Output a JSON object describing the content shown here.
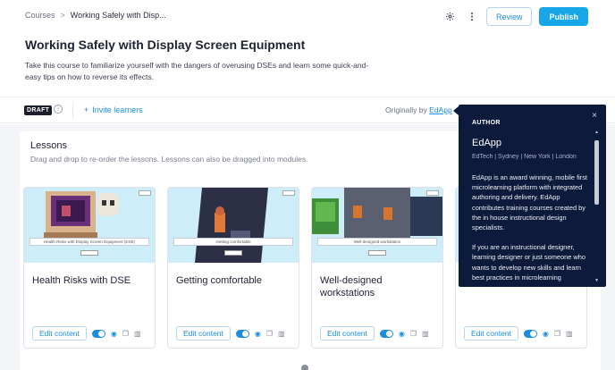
{
  "breadcrumb": {
    "root": "Courses",
    "separator": ">",
    "current": "Working Safely with Disp..."
  },
  "toolbar": {
    "settings_icon": "gear-icon",
    "more_icon": "kebab-menu-icon",
    "review_label": "Review",
    "publish_label": "Publish"
  },
  "course": {
    "title": "Working Safely with Display Screen Equipment",
    "description": "Take this course to familiarize yourself with the dangers of overusing DSEs and learn some quick-and-easy tips on how to reverse its effects."
  },
  "meta": {
    "status_badge": "DRAFT",
    "invite_icon": "+",
    "invite_label": "Invite learners",
    "originally_by": "Originally by",
    "author_link": "EdApp"
  },
  "lessons": {
    "heading": "Lessons",
    "subheading": "Drag and drop to re-order the lessons. Lessons can also be dragged into modules.",
    "edit_label": "Edit content",
    "items": [
      {
        "title": "Health Risks with DSE",
        "thumb_caption": "Health Risks with Display Screen Equipment (DSE)"
      },
      {
        "title": "Getting comfortable",
        "thumb_caption": "Getting comfortable"
      },
      {
        "title": "Well-designed workstations",
        "thumb_caption": "Well-designed workstation"
      },
      {
        "title": "",
        "thumb_caption": ""
      }
    ]
  },
  "author_popover": {
    "label": "AUTHOR",
    "close_icon": "×",
    "name": "EdApp",
    "locations": "EdTech | Sydney | New York | London",
    "para1": "EdApp is an award winning, mobile first microlearning platform with integrated authoring and delivery. EdApp contributes training courses created by the in house instructional design specialists.",
    "para2": "If you are an instructional designer, learning designer or just someone who wants to develop new skills and learn best practices in microlearning"
  },
  "colors": {
    "accent": "#17a6e8",
    "link": "#1a8ddc",
    "popover_bg": "#0c1a3b",
    "badge_bg": "#1b1e2c"
  }
}
